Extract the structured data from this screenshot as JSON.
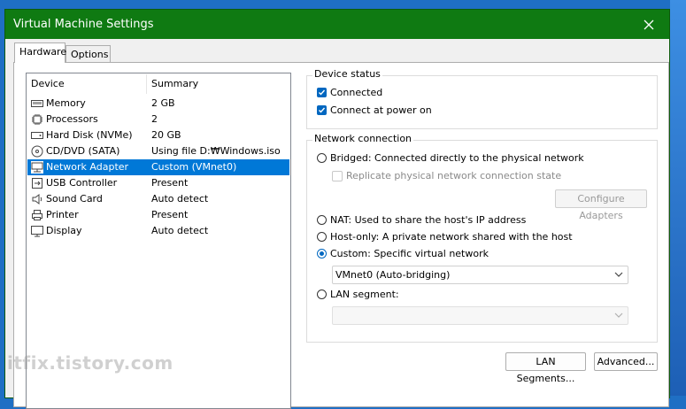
{
  "window": {
    "title": "Virtual Machine Settings",
    "close_glyph": "✕"
  },
  "tabs": [
    {
      "label": "Hardware"
    },
    {
      "label": "Options"
    }
  ],
  "device_list": {
    "headers": {
      "device": "Device",
      "summary": "Summary"
    },
    "rows": [
      {
        "name": "Memory",
        "summary": "2 GB",
        "icon": "memory-icon"
      },
      {
        "name": "Processors",
        "summary": "2",
        "icon": "processor-icon"
      },
      {
        "name": "Hard Disk (NVMe)",
        "summary": "20 GB",
        "icon": "hard-disk-icon"
      },
      {
        "name": "CD/DVD (SATA)",
        "summary": "Using file D:₩Windows.iso",
        "icon": "cd-dvd-icon"
      },
      {
        "name": "Network Adapter",
        "summary": "Custom (VMnet0)",
        "icon": "network-adapter-icon",
        "selected": true
      },
      {
        "name": "USB Controller",
        "summary": "Present",
        "icon": "usb-icon"
      },
      {
        "name": "Sound Card",
        "summary": "Auto detect",
        "icon": "speaker-icon"
      },
      {
        "name": "Printer",
        "summary": "Present",
        "icon": "printer-icon"
      },
      {
        "name": "Display",
        "summary": "Auto detect",
        "icon": "display-icon"
      }
    ]
  },
  "device_status": {
    "label": "Device status",
    "connected": {
      "label": "Connected",
      "checked": true
    },
    "connect_at_power_on": {
      "label": "Connect at power on",
      "checked": true
    }
  },
  "network_connection": {
    "label": "Network connection",
    "bridged": {
      "label": "Bridged: Connected directly to the physical network",
      "selected": false
    },
    "replicate": {
      "label": "Replicate physical network connection state",
      "checked": false,
      "disabled": true
    },
    "configure_adapters": {
      "label": "Configure Adapters",
      "disabled": true
    },
    "nat": {
      "label": "NAT: Used to share the host's IP address",
      "selected": false
    },
    "host_only": {
      "label": "Host-only: A private network shared with the host",
      "selected": false
    },
    "custom": {
      "label": "Custom: Specific virtual network",
      "selected": true
    },
    "custom_network_value": "VMnet0 (Auto-bridging)",
    "lan_segment": {
      "label": "LAN segment:",
      "selected": false
    },
    "lan_segment_value": ""
  },
  "buttons": {
    "lan_segments": "LAN Segments...",
    "advanced": "Advanced..."
  },
  "watermark": "itfix.tistory.com",
  "colors": {
    "titlebar": "#0f7a12",
    "accent": "#0067c0",
    "selection": "#0078d7"
  }
}
